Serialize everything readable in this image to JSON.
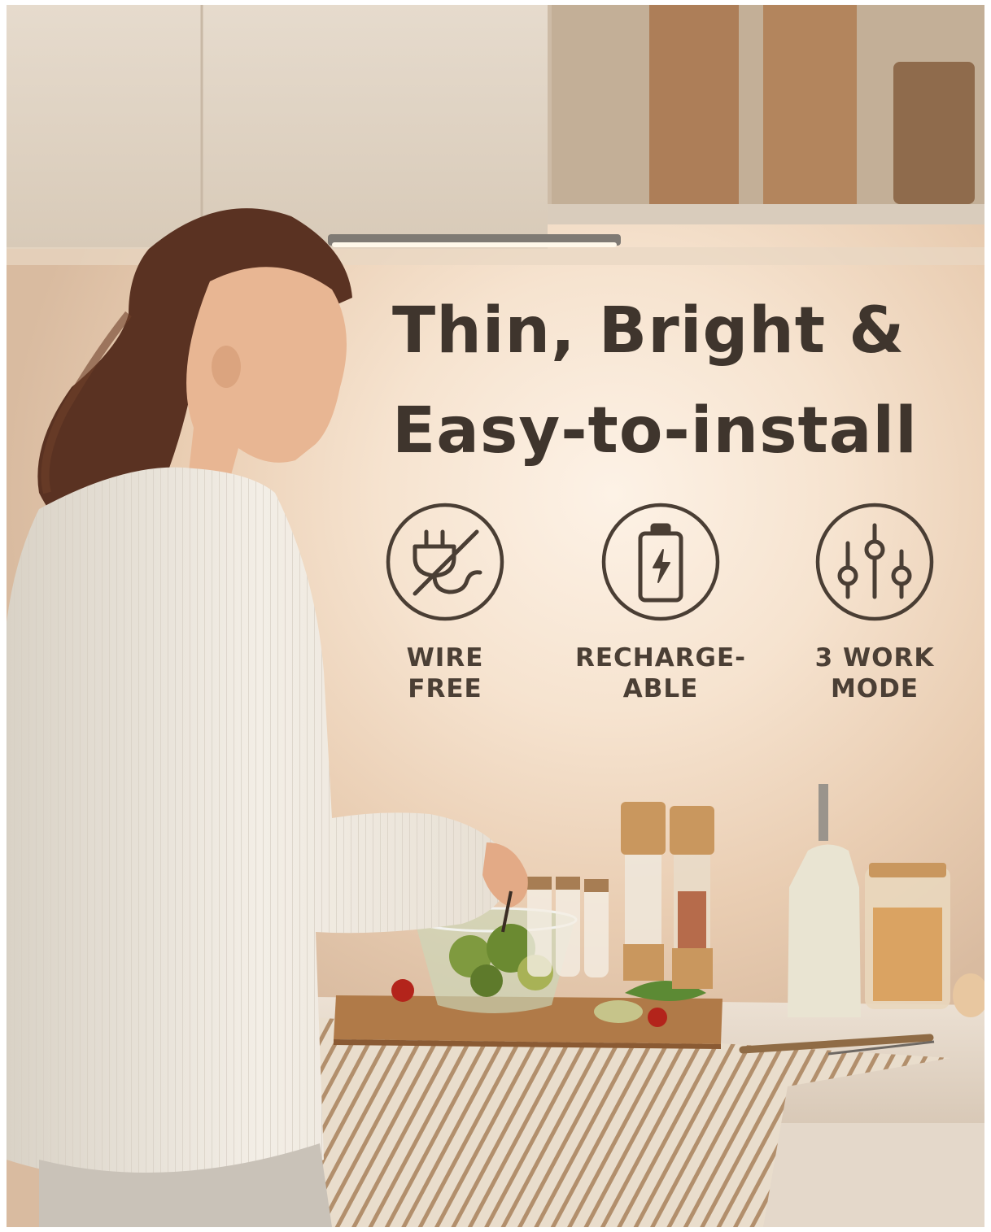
{
  "headline": {
    "line1": "Thin, Bright &",
    "line2": "Easy-to-install"
  },
  "features": [
    {
      "icon": "unplugged-plug-icon",
      "line1": "WIRE",
      "line2": "FREE"
    },
    {
      "icon": "battery-charging-icon",
      "line1": "RECHARGE-",
      "line2": "ABLE"
    },
    {
      "icon": "sliders-icon",
      "line1": "3 WORK",
      "line2": "MODE"
    }
  ],
  "colors": {
    "text": "#3f352d",
    "icon_stroke": "#4a3e34",
    "wall_glow": "#fdf2e6"
  }
}
